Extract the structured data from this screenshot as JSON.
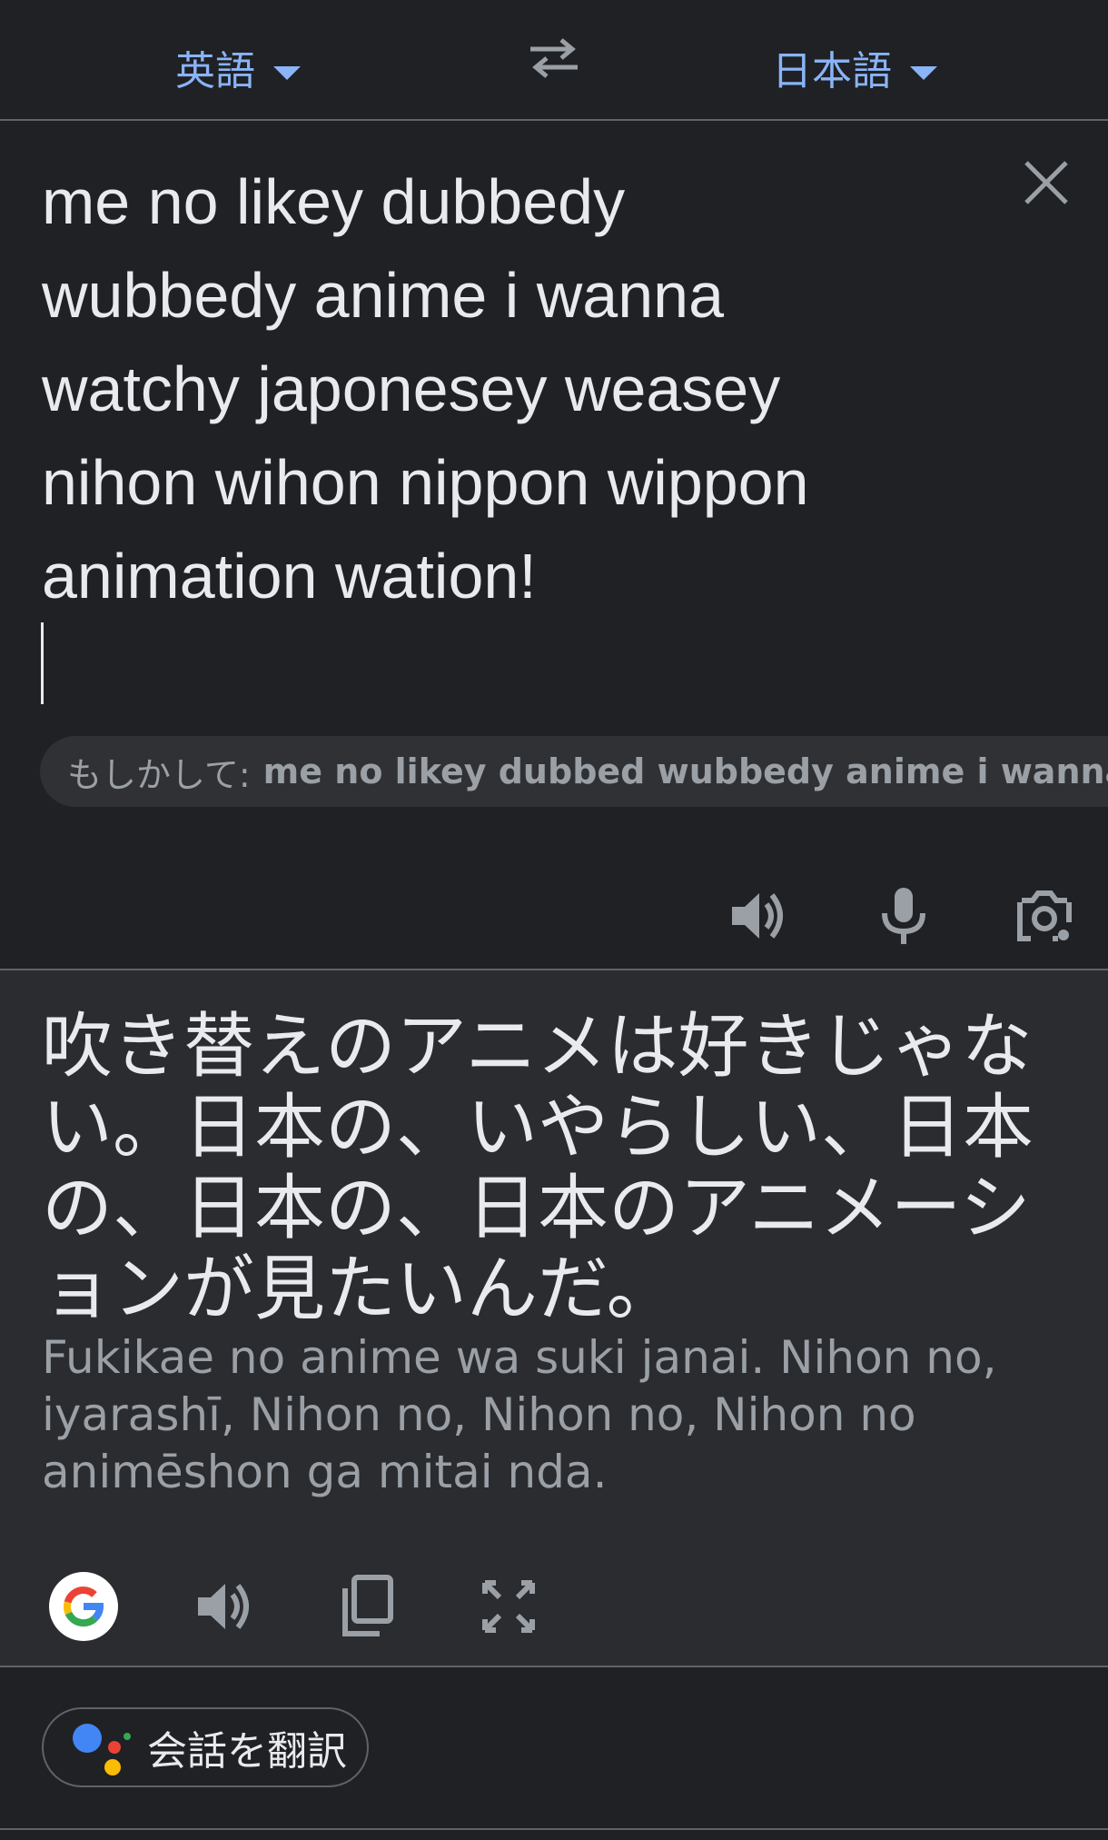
{
  "header": {
    "source_language": "英語",
    "target_language": "日本語"
  },
  "input": {
    "source_text": "me no likey dubbedy\nwubbedy anime i wanna\nwatchy japonesey weasey\nnihon wihon nippon wippon\nanimation wation!",
    "suggestion_prefix": "もしかして:",
    "suggestion_text": "me no likey dubbed wubbedy anime i wanna watchy japanesey weasey nihon wihon nippon wippon animation wation!"
  },
  "output": {
    "translated_text": "吹き替えのアニメは好きじゃない。日本の、いやらしい、日本の、日本の、日本のアニメーションが見たいんだ。",
    "romanization": "Fukikae no anime wa suki janai. Nihon no, iyarashī, Nihon no, Nihon no, Nihon no animēshon ga mitai nda."
  },
  "footer": {
    "conversation_label": "会話を翻訳"
  },
  "icons": {
    "swap": "swap-arrows-icon",
    "clear": "close-icon",
    "listen_source": "speaker-icon",
    "voice_input": "microphone-icon",
    "camera": "camera-icon",
    "google": "google-g-icon",
    "listen_output": "speaker-icon",
    "copy": "copy-icon",
    "fullscreen": "fullscreen-icon",
    "assistant": "google-assistant-icon"
  },
  "colors": {
    "accent_blue": "#8ab4f8",
    "background": "#202124",
    "output_background": "#2b2c30",
    "text_primary": "#e8eaed",
    "text_secondary": "#9aa0a6",
    "divider": "#5f6368"
  }
}
